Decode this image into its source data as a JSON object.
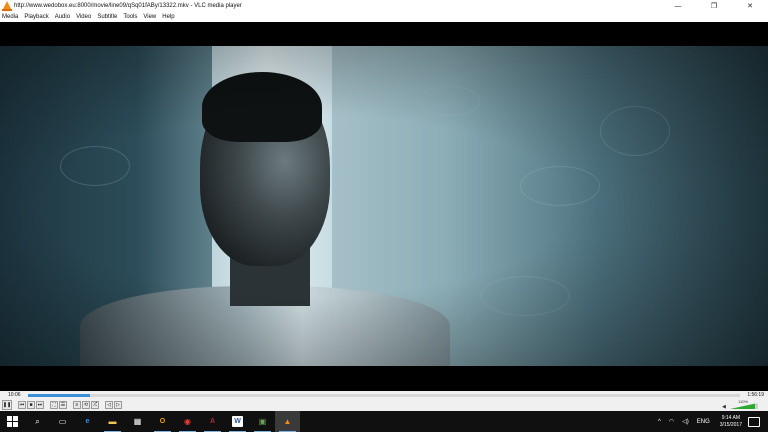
{
  "window": {
    "title": "http://www.wedobox.eu:8000/movie/line09/qSq01fABy/13322.mkv - VLC media player",
    "minimize_glyph": "—",
    "maximize_glyph": "❐",
    "close_glyph": "✕"
  },
  "menu": {
    "items": [
      "Media",
      "Playback",
      "Audio",
      "Video",
      "Subtitle",
      "Tools",
      "View",
      "Help"
    ]
  },
  "player": {
    "time_elapsed": "10:06",
    "time_total": "1:56:19",
    "progress_fraction": 0.087,
    "volume_percent_label": "110%",
    "volume_fraction": 0.9,
    "accent_color": "#3b8fd9"
  },
  "controls": {
    "pause": "❚❚",
    "prev": "⏮",
    "stop": "■",
    "next": "⏭",
    "fullscreen": "⛶",
    "extended": "☰",
    "playlist": "≡",
    "loop": "⟲",
    "random": "⤮",
    "frame_prev": "◁",
    "frame_next": "▷"
  },
  "taskbar": {
    "apps": [
      {
        "name": "start-button",
        "icon": "windows-logo-icon"
      },
      {
        "name": "search-button",
        "icon": "search-icon",
        "glyph": "⌕"
      },
      {
        "name": "task-view-button",
        "icon": "task-view-icon",
        "glyph": "▭"
      },
      {
        "name": "edge-button",
        "icon": "edge-icon",
        "glyph": "e",
        "color": "#3b8fd9"
      },
      {
        "name": "file-explorer-button",
        "icon": "folder-icon",
        "glyph": "▬",
        "color": "#f2c94c"
      },
      {
        "name": "store-button",
        "icon": "store-icon",
        "glyph": "▦",
        "color": "#ffffff"
      },
      {
        "name": "outlook-button",
        "icon": "outlook-icon",
        "glyph": "O",
        "color": "#f0a000"
      },
      {
        "name": "chrome-button",
        "icon": "chrome-icon",
        "glyph": "◉",
        "color": "#e94235"
      },
      {
        "name": "acrobat-button",
        "icon": "acrobat-icon",
        "glyph": "A",
        "color": "#c1272d"
      },
      {
        "name": "word-button",
        "icon": "word-icon",
        "glyph": "W",
        "color": "#2b5797"
      },
      {
        "name": "app-button",
        "icon": "app-icon",
        "glyph": "▣",
        "color": "#6aa84f"
      },
      {
        "name": "vlc-button",
        "icon": "vlc-icon",
        "glyph": "▲",
        "color": "#f28c1a"
      }
    ],
    "tray": {
      "chevron": "^",
      "network": "◠",
      "speaker": "◁)",
      "language": "ENG",
      "time": "9:14 AM",
      "date": "3/15/2017",
      "notification": ""
    }
  }
}
